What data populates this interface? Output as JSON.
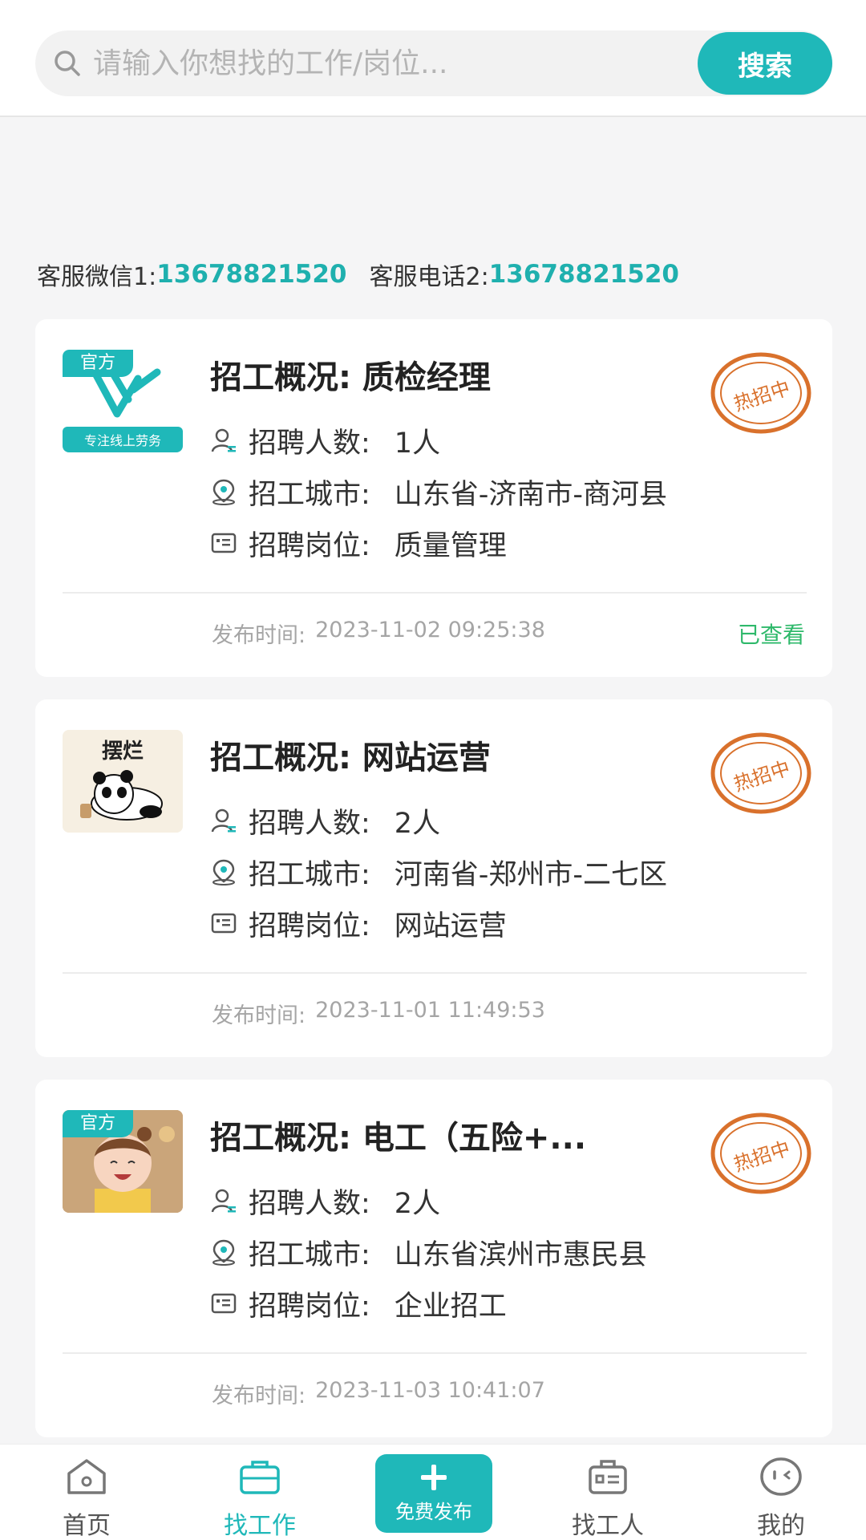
{
  "search": {
    "placeholder": "请输入你想找的工作/岗位...",
    "button_label": "搜索"
  },
  "contact": {
    "wechat_label": "客服微信1:",
    "wechat_number": "13678821520",
    "phone_label": "客服电话2:",
    "phone_number": "13678821520"
  },
  "labels": {
    "headcount": "招聘人数:",
    "city": "招工城市:",
    "position": "招聘岗位:",
    "publish_time": "发布时间:"
  },
  "jobs": [
    {
      "title": "招工概况:  质检经理",
      "badge": "官方",
      "logo_text": "专注线上劳务",
      "headcount": "1人",
      "city": "山东省-济南市-商河县",
      "position": "质量管理",
      "publish_time": "2023-11-02 09:25:38",
      "status": "已查看",
      "stamp": "热招中"
    },
    {
      "title": "招工概况:  网站运营",
      "logo_text": "摆烂",
      "headcount": "2人",
      "city": "河南省-郑州市-二七区",
      "position": "网站运营",
      "publish_time": "2023-11-01 11:49:53",
      "stamp": "热招中"
    },
    {
      "title": "招工概况:  电工（五险+...",
      "badge": "官方",
      "headcount": "2人",
      "city": "山东省滨州市惠民县",
      "position": "企业招工",
      "publish_time": "2023-11-03 10:41:07",
      "stamp": "热招中"
    }
  ],
  "nav": {
    "home": "首页",
    "find_job": "找工作",
    "publish": "免费发布",
    "find_worker": "找工人",
    "mine": "我的"
  },
  "colors": {
    "accent": "#1fb8b9",
    "viewed": "#2fb96b",
    "stamp": "#d9712c"
  }
}
